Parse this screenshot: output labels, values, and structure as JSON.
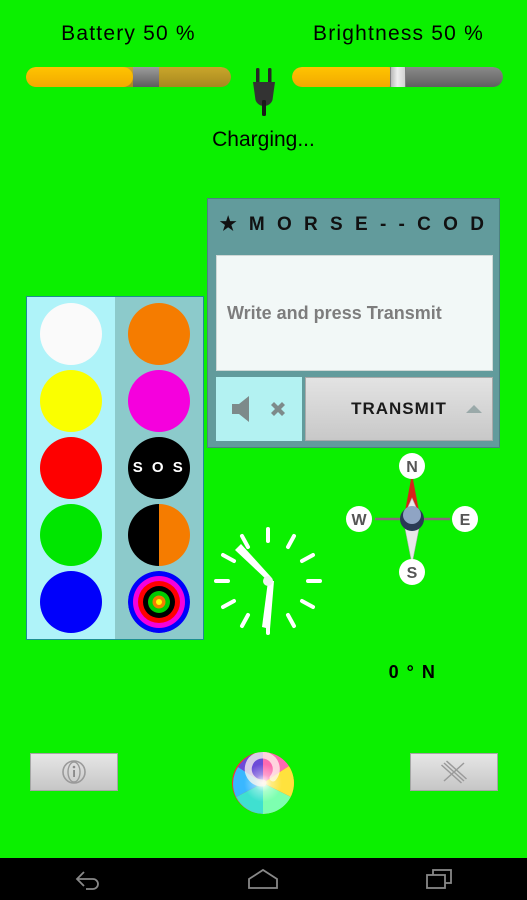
{
  "app": {
    "background_color": "#0bf000"
  },
  "battery": {
    "label": "Battery  50  %",
    "value": 50,
    "fill_color": "#ffc400",
    "track_color": "#c9a62b"
  },
  "brightness": {
    "label": "Brightness  50  %",
    "value": 50,
    "fill_color": "#ffc400",
    "track_color": "#7d7d7d"
  },
  "charging": {
    "icon": "power-plug-icon",
    "status_text": "Charging..."
  },
  "morse": {
    "title": "★ M O R S E - - C O D E ★",
    "input_value": "",
    "input_placeholder": "Write and press Transmit",
    "mute_icon": "speaker-mute-icon",
    "transmit_label": "TRANSMIT",
    "chevron_icon": "chevron-up-icon",
    "header_color": "#629b9c",
    "mute_bg_color": "#b3f2f2"
  },
  "palette": {
    "left_bg": "#aff3f9",
    "right_bg": "#8ccabb",
    "left_column": [
      {
        "name": "white",
        "color": "#fafafa"
      },
      {
        "name": "yellow",
        "color": "#faff00"
      },
      {
        "name": "red",
        "color": "#fe0000"
      },
      {
        "name": "green",
        "color": "#00e600"
      },
      {
        "name": "blue",
        "color": "#0000fb"
      }
    ],
    "right_column": [
      {
        "name": "orange",
        "color": "#f57c00"
      },
      {
        "name": "magenta",
        "color": "#f500dd"
      },
      {
        "name": "sos",
        "color": "#000000",
        "text": "S O S"
      },
      {
        "name": "police",
        "color": "#000000",
        "color2": "#f57c00"
      },
      {
        "name": "disco",
        "rings": [
          "#0000fb",
          "#f500dd",
          "#fe0000",
          "#000000",
          "#00cc00",
          "#f57c00",
          "#ffff00"
        ]
      }
    ]
  },
  "clock": {
    "hour": 10,
    "minute": 29,
    "tick_color": "#ffffff",
    "hand_color": "#ffffff"
  },
  "compass": {
    "north_label": "N",
    "east_label": "E",
    "south_label": "S",
    "west_label": "W",
    "heading_text": "0 °  N",
    "heading_degrees": 0,
    "needle_north_color": "#d8211a",
    "needle_south_color": "#e8e8e8"
  },
  "bottom_bar": {
    "info_icon": "info-circle-icon",
    "swirl_icon": "color-swirl-icon",
    "close_icon": "close-x-icon"
  },
  "navbar": {
    "back_icon": "back-arrow-icon",
    "home_icon": "home-icon",
    "recents_icon": "recents-icon"
  }
}
